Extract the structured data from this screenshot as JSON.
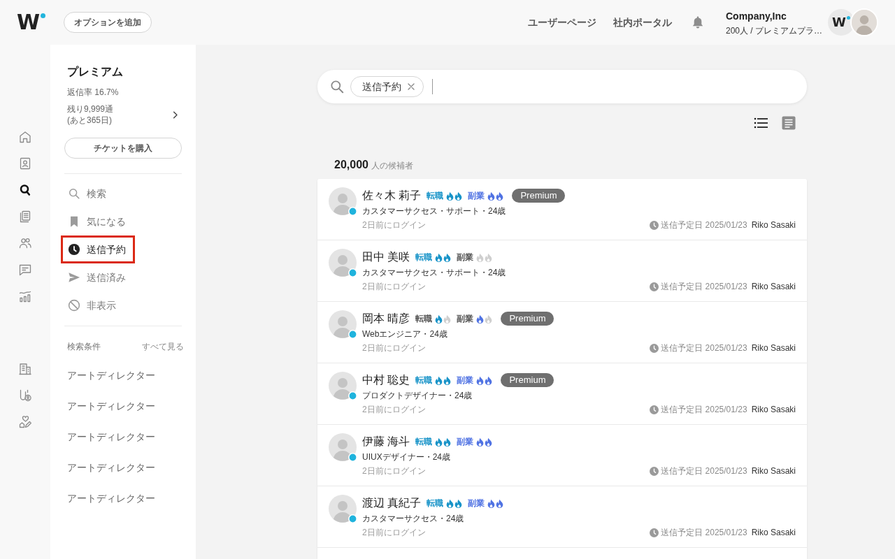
{
  "header": {
    "logo": "W",
    "option_button": "オプションを追加",
    "links": [
      {
        "label": "ユーザーページ"
      },
      {
        "label": "社内ポータル"
      }
    ],
    "account": {
      "company": "Company,Inc",
      "plan": "200人 / プレミアムプラ…",
      "logo": "W"
    }
  },
  "rail": {
    "top": [
      {
        "selected": false
      },
      {
        "selected": false
      },
      {
        "selected": true
      },
      {
        "selected": false
      },
      {
        "selected": false
      },
      {
        "selected": false
      },
      {
        "selected": false
      }
    ],
    "bottom": [
      {
        "selected": false
      },
      {
        "selected": false
      },
      {
        "selected": false
      }
    ]
  },
  "sidebar": {
    "plan": {
      "title": "プレミアム",
      "reply_rate": "返信率 16.7%",
      "remaining": "残り9,999通",
      "days_left": "(あと365日)",
      "button": "チケットを購入"
    },
    "nav_items": [
      {
        "label": "検索",
        "selected": false
      },
      {
        "label": "気になる",
        "selected": false
      },
      {
        "label": "送信予約",
        "selected": true
      },
      {
        "label": "送信済み",
        "selected": false
      },
      {
        "label": "非表示",
        "selected": false
      }
    ],
    "saved_searches": {
      "heading": "検索条件",
      "see_all": "すべて見る",
      "items": [
        "アートディレクター",
        "アートディレクター",
        "アートディレクター",
        "アートディレクター",
        "アートディレクター"
      ]
    }
  },
  "main": {
    "search": {
      "chips": [
        {
          "label": "送信予約"
        }
      ]
    },
    "view_modes": [
      {
        "selected": true
      },
      {
        "selected": false
      }
    ],
    "count": {
      "value": "20,000",
      "label": "人の候補者"
    },
    "candidates": [
      {
        "name": "佐々木 莉子",
        "online": true,
        "interests": [
          {
            "kind": "job_change",
            "label": "転職",
            "flames": [
              {
                "on": true
              },
              {
                "on": true
              }
            ]
          },
          {
            "kind": "side_job",
            "label": "副業",
            "flames": [
              {
                "on": true
              },
              {
                "on": true
              }
            ]
          }
        ],
        "badge": "Premium",
        "role": "カスタマーサクセス・サポート・24歳",
        "last_login": "2日前にログイン",
        "scheduled": "送信予定日 2025/01/23",
        "sender": "Riko Sasaki"
      },
      {
        "name": "田中 美咲",
        "online": true,
        "interests": [
          {
            "kind": "job_change",
            "label": "転職",
            "flames": [
              {
                "on": true
              },
              {
                "on": true
              }
            ]
          },
          {
            "kind": "side_job",
            "label": "副業",
            "flames": [
              {
                "on": false
              },
              {
                "on": false
              }
            ]
          }
        ],
        "role": "カスタマーサクセス・サポート・24歳",
        "last_login": "2日前にログイン",
        "scheduled": "送信予定日 2025/01/23",
        "sender": "Riko Sasaki"
      },
      {
        "name": "岡本 晴彦",
        "online": true,
        "interests": [
          {
            "kind": "job_change",
            "label": "転職",
            "flames": [
              {
                "on": true
              },
              {
                "on": false
              }
            ]
          },
          {
            "kind": "side_job",
            "label": "副業",
            "flames": [
              {
                "on": true
              },
              {
                "on": false
              }
            ]
          }
        ],
        "badge": "Premium",
        "role": "Webエンジニア・24歳",
        "last_login": "2日前にログイン",
        "scheduled": "送信予定日 2025/01/23",
        "sender": "Riko Sasaki"
      },
      {
        "name": "中村 聡史",
        "online": true,
        "interests": [
          {
            "kind": "job_change",
            "label": "転職",
            "flames": [
              {
                "on": true
              },
              {
                "on": true
              }
            ]
          },
          {
            "kind": "side_job",
            "label": "副業",
            "flames": [
              {
                "on": true
              },
              {
                "on": true
              }
            ]
          }
        ],
        "badge": "Premium",
        "role": "プロダクトデザイナー・24歳",
        "last_login": "2日前にログイン",
        "scheduled": "送信予定日 2025/01/23",
        "sender": "Riko Sasaki"
      },
      {
        "name": "伊藤 海斗",
        "online": true,
        "interests": [
          {
            "kind": "job_change",
            "label": "転職",
            "flames": [
              {
                "on": true
              },
              {
                "on": true
              }
            ]
          },
          {
            "kind": "side_job",
            "label": "副業",
            "flames": [
              {
                "on": true
              },
              {
                "on": true
              }
            ]
          }
        ],
        "role": "UIUXデザイナー・24歳",
        "last_login": "2日前にログイン",
        "scheduled": "送信予定日 2025/01/23",
        "sender": "Riko Sasaki"
      },
      {
        "name": "渡辺 真紀子",
        "online": true,
        "interests": [
          {
            "kind": "job_change",
            "label": "転職",
            "flames": [
              {
                "on": true
              },
              {
                "on": true
              }
            ]
          },
          {
            "kind": "side_job",
            "label": "副業",
            "flames": [
              {
                "on": true
              },
              {
                "on": true
              }
            ]
          }
        ],
        "role": "カスタマーサクセス・24歳",
        "last_login": "2日前にログイン",
        "scheduled": "送信予定日 2025/01/23",
        "sender": "Riko Sasaki"
      }
    ]
  }
}
